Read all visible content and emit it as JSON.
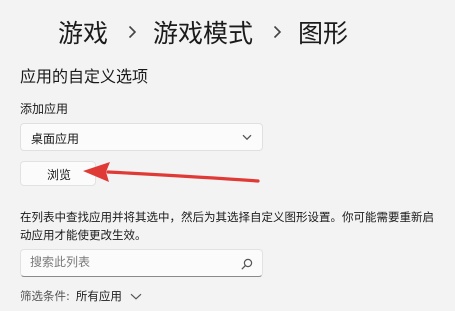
{
  "breadcrumb": {
    "items": [
      "游戏",
      "游戏模式",
      "图形"
    ]
  },
  "section": {
    "title": "应用的自定义选项",
    "add_app_label": "添加应用",
    "app_type": "桌面应用",
    "browse_label": "浏览"
  },
  "description": "在列表中查找应用并将其选中，然后为其选择自定义图形设置。你可能需要重新启动应用才能使更改生效。",
  "search": {
    "placeholder": "搜索此列表"
  },
  "filter": {
    "label": "筛选条件:",
    "value": "所有应用"
  },
  "icons": {
    "breadcrumb_separator": "chevron-right-icon",
    "dropdown": "chevron-down-icon",
    "search": "search-icon",
    "filter": "chevron-down-icon",
    "annotation": "red-arrow-icon"
  },
  "colors": {
    "background": "#f3f3f3",
    "annotation_arrow": "#e03a36"
  }
}
